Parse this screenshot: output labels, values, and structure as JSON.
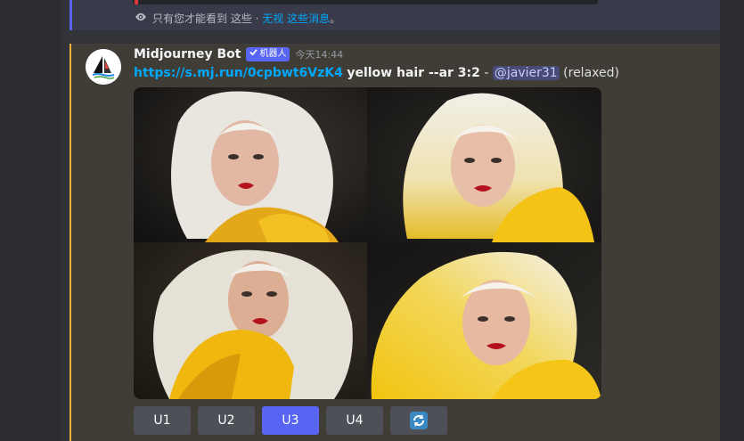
{
  "ephemeral": {
    "visibility_text": "只有您才能看到 这些 · ",
    "dismiss_text": "无视 这些消息",
    "tail": "。"
  },
  "message": {
    "username": "Midjourney Bot",
    "bot_badge": "机器人",
    "timestamp": "今天14:44",
    "link": "https://s.mj.run/0cpbwt6VzK4",
    "prompt": "yellow hair --ar 3:2",
    "separator": "-",
    "mention": "@javier31",
    "mode": "(relaxed)"
  },
  "grid_images": [
    {
      "name": "image-1",
      "description_icon": "portrait-image"
    },
    {
      "name": "image-2",
      "description_icon": "portrait-image"
    },
    {
      "name": "image-3",
      "description_icon": "portrait-image"
    },
    {
      "name": "image-4",
      "description_icon": "portrait-image"
    }
  ],
  "buttons": {
    "u1": "U1",
    "u2": "U2",
    "u3": "U3",
    "u4": "U4",
    "reroll_icon": "refresh-icon"
  },
  "colors": {
    "accent": "#5865f2",
    "highlight_border": "#f0b232",
    "link": "#00a8fc"
  }
}
